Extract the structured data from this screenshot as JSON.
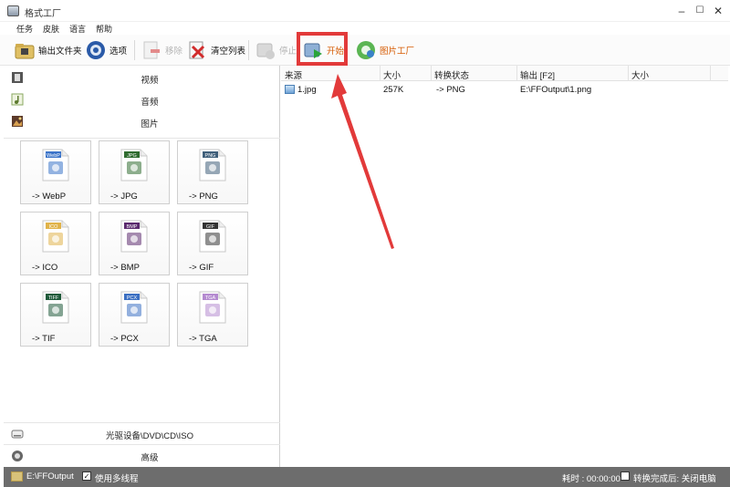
{
  "window": {
    "title": "格式工厂",
    "minimize": "–",
    "maximize": "☐",
    "close": "✕"
  },
  "menu": [
    "任务",
    "皮肤",
    "语言",
    "帮助"
  ],
  "toolbar": {
    "output_folder": "输出文件夹",
    "options": "选项",
    "remove": "移除",
    "clear_list": "清空列表",
    "stop": "停止",
    "start": "开始",
    "picture_factory": "图片工厂"
  },
  "categories": {
    "video": "视频",
    "audio": "音频",
    "picture": "图片",
    "disc": "光驱设备\\DVD\\CD\\ISO",
    "advanced": "高级"
  },
  "tiles": [
    {
      "label": "-> WebP",
      "badge": "WebP",
      "color": "#3b74c9"
    },
    {
      "label": "-> JPG",
      "badge": "JPG",
      "color": "#2f6b2f"
    },
    {
      "label": "-> PNG",
      "badge": "PNG",
      "color": "#3f5f7a"
    },
    {
      "label": "-> ICO",
      "badge": "ICO",
      "color": "#e0b34a"
    },
    {
      "label": "-> BMP",
      "badge": "BMP",
      "color": "#5b2a6e"
    },
    {
      "label": "-> GIF",
      "badge": "GIF",
      "color": "#333333"
    },
    {
      "label": "-> TIF",
      "badge": "TIFF",
      "color": "#1f5a3a"
    },
    {
      "label": "-> PCX",
      "badge": "PCX",
      "color": "#3b6fc2"
    },
    {
      "label": "-> TGA",
      "badge": "TGA",
      "color": "#b48ad0"
    }
  ],
  "grid": {
    "headers": [
      "来源",
      "大小",
      "转换状态",
      "输出 [F2]",
      "大小"
    ],
    "rows": [
      {
        "source": "1.jpg",
        "size": "257K",
        "status": "-> PNG",
        "output": "E:\\FFOutput\\1.png",
        "out_size": ""
      }
    ]
  },
  "status": {
    "output_path": "E:\\FFOutput",
    "multithread_label": "使用多线程",
    "elapsed": "耗时 : 00:00:00",
    "after_done": "转换完成后: 关闭电脑"
  },
  "colors": {
    "highlight": "#e23a3a",
    "statusbar": "#6d6d6d"
  }
}
